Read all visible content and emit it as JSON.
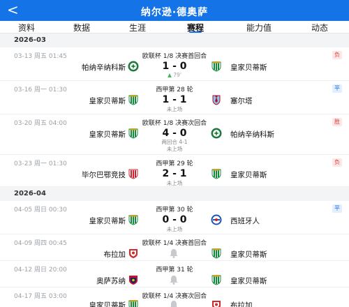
{
  "header": {
    "back": "<",
    "title": "纳尔逊·德奥萨"
  },
  "tabs": [
    "资料",
    "数据",
    "生涯",
    "赛程",
    "能力值",
    "动态"
  ],
  "active_tab": "赛程",
  "months": [
    "2026-03",
    "2026-04"
  ],
  "matches": [
    {
      "date": "03-13  周五 01:45",
      "comp": "欧联杯 1/8 决赛首回合",
      "home": "帕纳辛纳科斯",
      "home_logo": "panathinaikos",
      "score": "1 - 0",
      "away": "皇家贝蒂斯",
      "away_logo": "betis",
      "note": "79'",
      "result": "负"
    },
    {
      "date": "03-16  周一 01:30",
      "comp": "西甲第 28 轮",
      "home": "皇家贝蒂斯",
      "home_logo": "betis",
      "score": "1 - 1",
      "away": "塞尔塔",
      "away_logo": "celta",
      "note": "未上场",
      "result": "平"
    },
    {
      "date": "03-20  周五 04:00",
      "comp": "欧联杯 1/8 决赛次回合",
      "home": "皇家贝蒂斯",
      "home_logo": "betis",
      "score": "4 - 0",
      "away": "帕纳辛纳科斯",
      "away_logo": "panathinaikos",
      "extra": "两回合 4-1",
      "note": "未上场",
      "result": "胜"
    },
    {
      "date": "03-23  周一 01:30",
      "comp": "西甲第 29 轮",
      "home": "毕尔巴鄂竞技",
      "home_logo": "athletic-bilbao",
      "score": "2 - 1",
      "away": "皇家贝蒂斯",
      "away_logo": "betis",
      "note": "未上场",
      "result": "负"
    },
    {
      "date": "04-05  周日 00:30",
      "comp": "西甲第 30 轮",
      "home": "皇家贝蒂斯",
      "home_logo": "betis",
      "score": "0 - 0",
      "away": "西班牙人",
      "away_logo": "espanyol",
      "note": "未上场",
      "result": "平"
    },
    {
      "date": "04-09  周四 00:45",
      "comp": "欧联杯 1/4 决赛首回合",
      "home": "布拉加",
      "home_logo": "braga",
      "away": "皇家贝蒂斯",
      "away_logo": "betis"
    },
    {
      "date": "04-12  周日 20:00",
      "comp": "西甲第 31 轮",
      "home": "奥萨苏纳",
      "home_logo": "osasuna",
      "away": "皇家贝蒂斯",
      "away_logo": "betis"
    },
    {
      "date": "04-17  周五 03:00",
      "comp": "欧联杯 1/4 决赛次回合",
      "home": "皇家贝蒂斯",
      "home_logo": "betis",
      "away": "布拉加",
      "away_logo": "braga"
    }
  ],
  "colors": {
    "brand": "#1573e8",
    "win": "#2e9a49",
    "draw": "#1e6fd9",
    "loss": "#d64141"
  }
}
